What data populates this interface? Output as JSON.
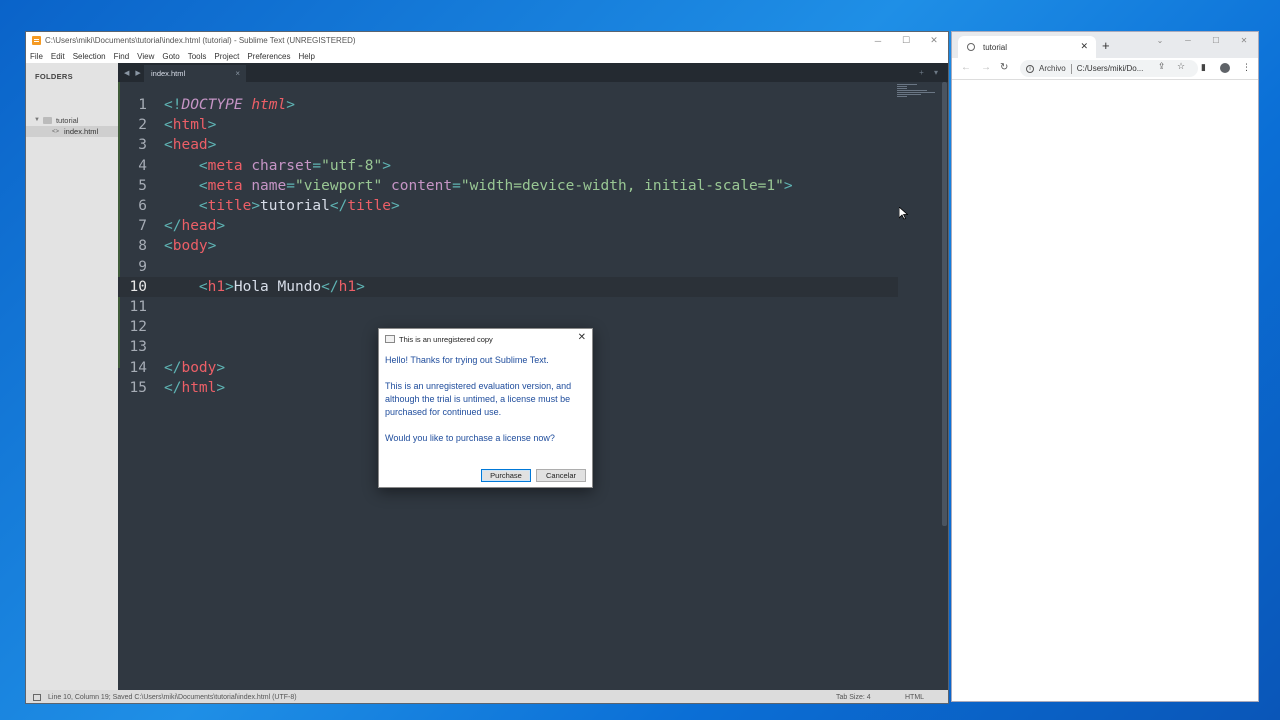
{
  "sublime": {
    "window_title": "C:\\Users\\miki\\Documents\\tutorial\\index.html (tutorial) - Sublime Text (UNREGISTERED)",
    "menu": [
      "File",
      "Edit",
      "Selection",
      "Find",
      "View",
      "Goto",
      "Tools",
      "Project",
      "Preferences",
      "Help"
    ],
    "sidebar": {
      "header": "FOLDERS",
      "folder": "tutorial",
      "file": "index.html"
    },
    "tab": {
      "label": "index.html",
      "close": "×"
    },
    "tab_nav": "◀ ▶",
    "tab_tools": "+ ▾",
    "editor": {
      "current_line": 10,
      "lines": [
        {
          "n": "1",
          "tokens": [
            [
              "punct",
              "<!"
            ],
            [
              "kw",
              "DOCTYPE"
            ],
            [
              "text",
              " "
            ],
            [
              "em",
              "html"
            ],
            [
              "punct",
              ">"
            ]
          ]
        },
        {
          "n": "2",
          "tokens": [
            [
              "punct",
              "<"
            ],
            [
              "tag",
              "html"
            ],
            [
              "punct",
              ">"
            ]
          ]
        },
        {
          "n": "3",
          "tokens": [
            [
              "punct",
              "<"
            ],
            [
              "tag",
              "head"
            ],
            [
              "punct",
              ">"
            ]
          ]
        },
        {
          "n": "4",
          "tokens": [
            [
              "text",
              "    "
            ],
            [
              "punct",
              "<"
            ],
            [
              "tag",
              "meta"
            ],
            [
              "text",
              " "
            ],
            [
              "attr",
              "charset"
            ],
            [
              "punct",
              "="
            ],
            [
              "str",
              "\"utf-8\""
            ],
            [
              "punct",
              ">"
            ]
          ]
        },
        {
          "n": "5",
          "tokens": [
            [
              "text",
              "    "
            ],
            [
              "punct",
              "<"
            ],
            [
              "tag",
              "meta"
            ],
            [
              "text",
              " "
            ],
            [
              "attr",
              "name"
            ],
            [
              "punct",
              "="
            ],
            [
              "str",
              "\"viewport\""
            ],
            [
              "text",
              " "
            ],
            [
              "attr",
              "content"
            ],
            [
              "punct",
              "="
            ],
            [
              "str",
              "\"width=device-width, initial-scale=1\""
            ],
            [
              "punct",
              ">"
            ]
          ]
        },
        {
          "n": "6",
          "tokens": [
            [
              "text",
              "    "
            ],
            [
              "punct",
              "<"
            ],
            [
              "tag",
              "title"
            ],
            [
              "punct",
              ">"
            ],
            [
              "text",
              "tutorial"
            ],
            [
              "punct",
              "</"
            ],
            [
              "tag",
              "title"
            ],
            [
              "punct",
              ">"
            ]
          ]
        },
        {
          "n": "7",
          "tokens": [
            [
              "punct",
              "</"
            ],
            [
              "tag",
              "head"
            ],
            [
              "punct",
              ">"
            ]
          ]
        },
        {
          "n": "8",
          "tokens": [
            [
              "punct",
              "<"
            ],
            [
              "tag",
              "body"
            ],
            [
              "punct",
              ">"
            ]
          ]
        },
        {
          "n": "9",
          "tokens": []
        },
        {
          "n": "10",
          "tokens": [
            [
              "text",
              "    "
            ],
            [
              "punct",
              "<"
            ],
            [
              "tag",
              "h1"
            ],
            [
              "punct",
              ">"
            ],
            [
              "text",
              "Hola Mundo"
            ],
            [
              "punct",
              "</"
            ],
            [
              "tag",
              "h1"
            ],
            [
              "punct",
              ">"
            ]
          ]
        },
        {
          "n": "11",
          "tokens": []
        },
        {
          "n": "12",
          "tokens": []
        },
        {
          "n": "13",
          "tokens": []
        },
        {
          "n": "14",
          "tokens": [
            [
              "punct",
              "</"
            ],
            [
              "tag",
              "body"
            ],
            [
              "punct",
              ">"
            ]
          ]
        },
        {
          "n": "15",
          "tokens": [
            [
              "punct",
              "</"
            ],
            [
              "tag",
              "html"
            ],
            [
              "punct",
              ">"
            ]
          ]
        }
      ]
    },
    "status": {
      "left": "Line 10, Column 19; Saved C:\\Users\\miki\\Documents\\tutorial\\index.html (UTF-8)",
      "tab_size": "Tab Size: 4",
      "syntax": "HTML"
    }
  },
  "dialog": {
    "title": "This is an unregistered copy",
    "greeting": "Hello! Thanks for trying out Sublime Text.",
    "body": "This is an unregistered evaluation version, and although the trial is untimed, a license must be purchased for continued use.",
    "question": "Would you like to purchase a license now?",
    "purchase_label": "Purchase",
    "cancel_label": "Cancelar"
  },
  "chrome": {
    "tab_title": "tutorial",
    "scheme_label": "Archivo",
    "url": "C:/Users/miki/Do..."
  },
  "icons": {
    "window_controls": [
      "minimize-icon",
      "maximize-icon",
      "close-icon"
    ],
    "chrome_nav": [
      "back-icon",
      "forward-icon",
      "reload-icon"
    ]
  }
}
